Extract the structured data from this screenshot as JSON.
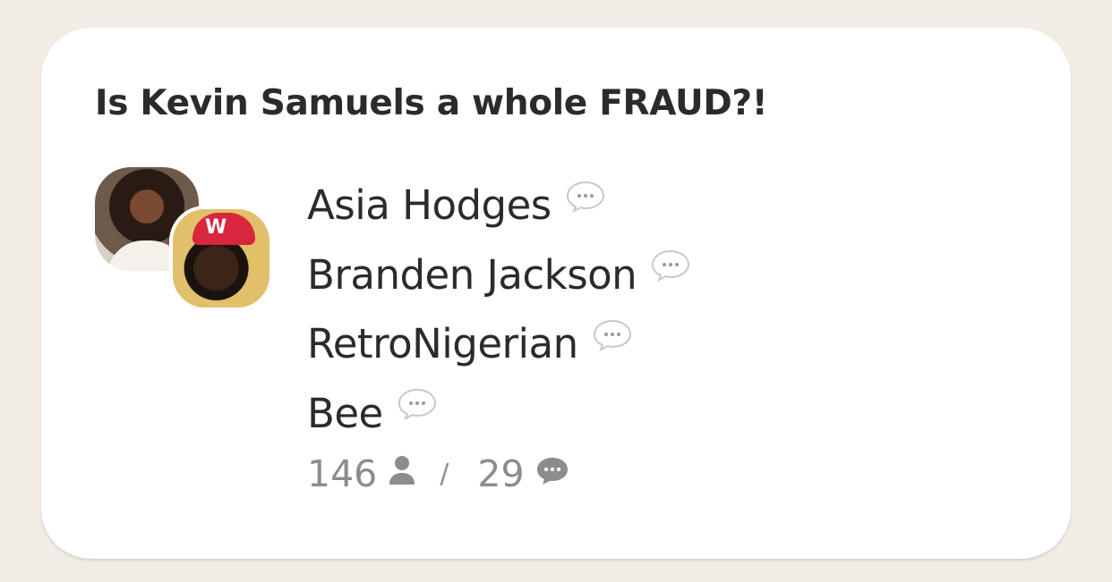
{
  "room": {
    "title": "Is Kevin Samuels a whole FRAUD?!",
    "speakers": [
      {
        "name": "Asia Hodges",
        "icon": "speech-bubble-icon"
      },
      {
        "name": "Branden Jackson",
        "icon": "speech-bubble-icon"
      },
      {
        "name": "RetroNigerian",
        "icon": "speech-bubble-icon"
      },
      {
        "name": "Bee",
        "icon": "speech-bubble-icon"
      }
    ],
    "stats": {
      "listeners": "146",
      "listeners_icon": "person-icon",
      "divider": "/",
      "speakers_count": "29",
      "speakers_icon": "chat-bubble-icon"
    }
  },
  "colors": {
    "background": "#f1ede4",
    "card": "#ffffff",
    "title_text": "#2b2b2b",
    "muted_text": "#8c8c8c"
  }
}
